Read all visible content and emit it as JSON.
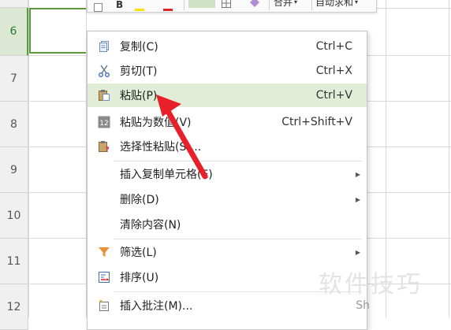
{
  "sheet": {
    "row_numbers": [
      "6",
      "7",
      "8",
      "9",
      "10",
      "11",
      "12"
    ]
  },
  "mini_toolbar": {
    "merge_label": "合并",
    "autosum_label": "自动求和",
    "bold_label": "B"
  },
  "context_menu": {
    "items": [
      {
        "label": "复制(C)",
        "shortcut": "Ctrl+C",
        "icon": "copy-icon"
      },
      {
        "label": "剪切(T)",
        "shortcut": "Ctrl+X",
        "icon": "scissors-icon"
      },
      {
        "label": "粘贴(P)",
        "shortcut": "Ctrl+V",
        "icon": "paste-icon"
      },
      {
        "label": "粘贴为数值(V)",
        "shortcut": "Ctrl+Shift+V",
        "icon": "paste-values-icon"
      },
      {
        "label": "选择性粘贴(S)...",
        "shortcut": "",
        "icon": "paste-special-icon"
      },
      {
        "label": "插入复制单元格(E)",
        "shortcut": "",
        "icon": ""
      },
      {
        "label": "删除(D)",
        "shortcut": "",
        "icon": ""
      },
      {
        "label": "清除内容(N)",
        "shortcut": "",
        "icon": ""
      },
      {
        "label": "筛选(L)",
        "shortcut": "",
        "icon": "filter-icon"
      },
      {
        "label": "排序(U)",
        "shortcut": "",
        "icon": "sort-icon"
      },
      {
        "label": "插入批注(M)...",
        "shortcut": "Sh",
        "icon": "comment-icon"
      }
    ]
  },
  "colors": {
    "highlight": "#e1edd7",
    "active_border": "#5b9a3c",
    "arrow": "#e8202a"
  },
  "watermark": "软件技巧"
}
